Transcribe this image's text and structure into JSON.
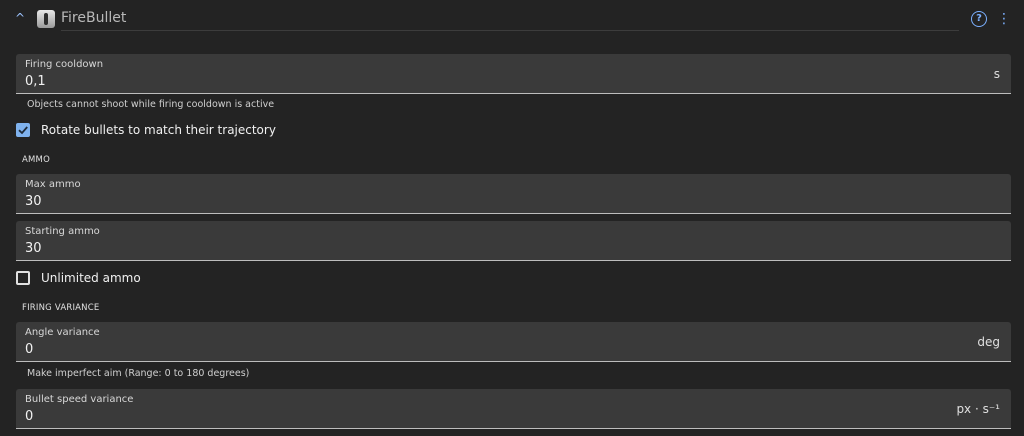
{
  "header": {
    "collapse_glyph": "^",
    "behavior_icon": "behavior-icon",
    "behavior_name": "FireBullet",
    "help_glyph": "?",
    "more_glyph": "⋮"
  },
  "firing_cooldown": {
    "label": "Firing cooldown",
    "value": "0,1",
    "unit": "s",
    "helper": "Objects cannot shoot while firing cooldown is active"
  },
  "rotate_bullets": {
    "label": "Rotate bullets to match their trajectory",
    "checked": true
  },
  "ammo_section": {
    "title": "AMMO",
    "max_ammo": {
      "label": "Max ammo",
      "value": "30"
    },
    "starting_ammo": {
      "label": "Starting ammo",
      "value": "30"
    },
    "unlimited_ammo": {
      "label": "Unlimited ammo",
      "checked": false
    }
  },
  "firing_variance_section": {
    "title": "FIRING VARIANCE",
    "angle_variance": {
      "label": "Angle variance",
      "value": "0",
      "unit": "deg",
      "helper": "Make imperfect aim (Range: 0 to 180 degrees)"
    },
    "bullet_speed_variance": {
      "label": "Bullet speed variance",
      "value": "0",
      "unit": "px · s⁻¹"
    }
  },
  "colors": {
    "background": "#232323",
    "field_background": "#3a3a3a",
    "accent": "#7fb2ee"
  }
}
